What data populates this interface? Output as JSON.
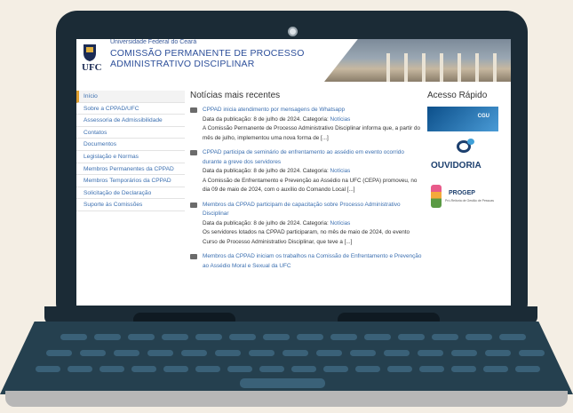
{
  "header": {
    "university": "Universidade Federal do Ceará",
    "logo_text": "UFC",
    "title_line1": "COMISSÃO PERMANENTE DE PROCESSO",
    "title_line2": "ADMINISTRATIVO DISCIPLINAR"
  },
  "sidebar": {
    "items": [
      {
        "label": "Início"
      },
      {
        "label": "Sobre a CPPAD/UFC"
      },
      {
        "label": "Assessoria de Admissibilidade"
      },
      {
        "label": "Contatos"
      },
      {
        "label": "Documentos"
      },
      {
        "label": "Legislação e Normas"
      },
      {
        "label": "Membros Permanentes da CPPAD"
      },
      {
        "label": "Membros Temporários da CPPAD"
      },
      {
        "label": "Solicitação de Declaração"
      },
      {
        "label": "Suporte às Comissões"
      }
    ]
  },
  "main": {
    "heading": "Notícias mais recentes",
    "news": [
      {
        "title": "CPPAD inicia atendimento por mensagens de Whatsapp",
        "meta": "Data da publicação: 8 de julho de 2024. Categoria:",
        "category": "Notícias",
        "body": "A Comissão Permanente de Processo Administrativo Disciplinar informa que, a partir do mês de julho, implementou uma nova forma de [...]"
      },
      {
        "title": "CPPAD participa de seminário de enfrentamento ao assédio em evento ocorrido durante a greve dos servidores",
        "meta": "Data da publicação: 8 de julho de 2024. Categoria:",
        "category": "Notícias",
        "body": "A Comissão de Enfrentamento e Prevenção ao Assédio na UFC (CEPA) promoveu, no dia 09 de maio de 2024, com o auxílio do Comando Local [...]"
      },
      {
        "title": "Membros da CPPAD participam de capacitação sobre Processo Administrativo Disciplinar",
        "meta": "Data da publicação: 8 de julho de 2024. Categoria:",
        "category": "Notícias",
        "body": "Os servidores lotados na CPPAD participaram, no mês de maio de 2024, do evento Curso de Processo Administrativo Disciplinar, que teve a [...]"
      },
      {
        "title": "Membros da CPPAD iniciam os trabalhos na Comissão de Enfrentamento e Prevenção ao Assédio Moral e Sexual da UFC",
        "meta": "",
        "category": "",
        "body": ""
      }
    ]
  },
  "quick_access": {
    "heading": "Acesso Rápido",
    "cgu_label": "CGU",
    "ouvidoria_label": "OUVIDORIA",
    "progep_label": "PROGEP",
    "progep_sub": "Pró-Reitoria de Gestão de Pessoas"
  },
  "colors": {
    "frame": "#1b2b36",
    "keyboard": "#25404f",
    "link": "#3b6fb0",
    "background": "#f4eee4"
  }
}
